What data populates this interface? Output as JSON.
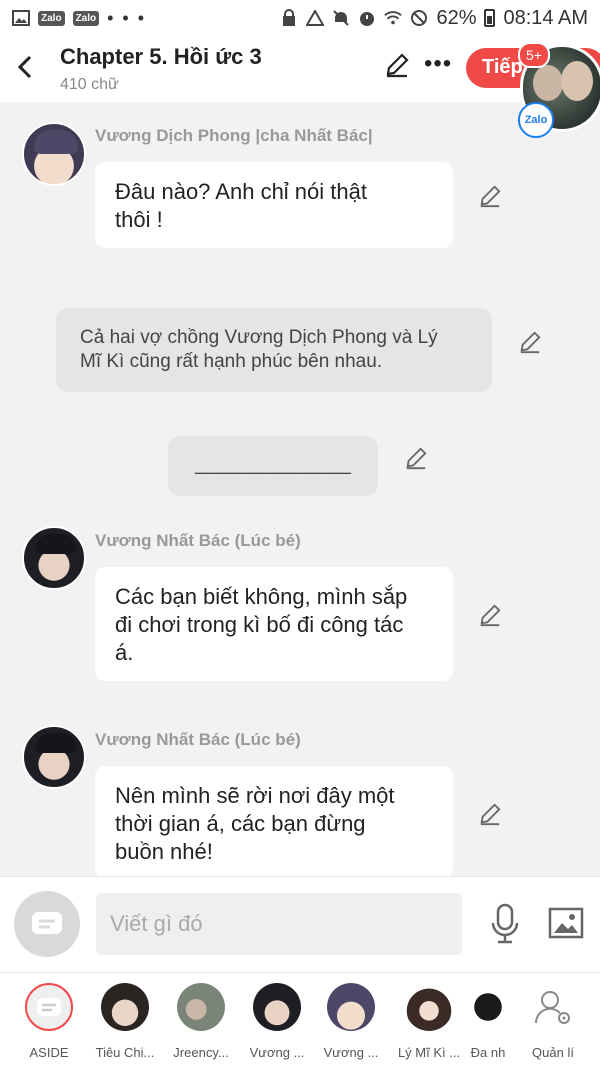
{
  "status_bar": {
    "notif_chips": [
      "Zalo",
      "Zalo"
    ],
    "more_dots": "• • •",
    "battery": "62%",
    "time": "08:14 AM"
  },
  "header": {
    "title": "Chapter 5. Hồi ức 3",
    "word_count": "410 chữ",
    "next_label": "Tiếp",
    "next_badge": "5+",
    "zalo_label": "Zalo"
  },
  "messages": [
    {
      "type": "character",
      "sender": "Vương Dịch Phong |cha Nhất Bác|",
      "lines": [
        "Đâu nào? Anh chỉ nói thật",
        "thôi !"
      ]
    },
    {
      "type": "narration",
      "lines": [
        "Cả hai vợ chồng Vương Dịch Phong và Lý",
        "Mĩ Kì cũng rất hạnh phúc bên nhau."
      ]
    },
    {
      "type": "divider",
      "text": "______________"
    },
    {
      "type": "character",
      "sender": "Vương Nhất Bác (Lúc bé)",
      "lines": [
        "Các bạn biết không, mình sắp",
        "đi chơi trong kì bố đi công tác",
        "á."
      ]
    },
    {
      "type": "character",
      "sender": "Vương Nhất Bác (Lúc bé)",
      "lines": [
        "Nên mình sẽ rời nơi đây một",
        "thời gian á, các bạn đừng",
        "buồn nhé!"
      ]
    }
  ],
  "input": {
    "placeholder": "Viết gì đó"
  },
  "characters": [
    {
      "name": "ASIDE"
    },
    {
      "name": "Tiêu Chi..."
    },
    {
      "name": "Jreency..."
    },
    {
      "name": "Vương ..."
    },
    {
      "name": "Vương ..."
    },
    {
      "name": "Lý Mĩ Kì ..."
    },
    {
      "name": "Đa nh"
    },
    {
      "name": "Quản lí"
    }
  ],
  "colors": {
    "accent": "#f04a48",
    "background": "#f2f2f2",
    "bubble": "#ffffff",
    "narration": "#e5e5e5"
  }
}
